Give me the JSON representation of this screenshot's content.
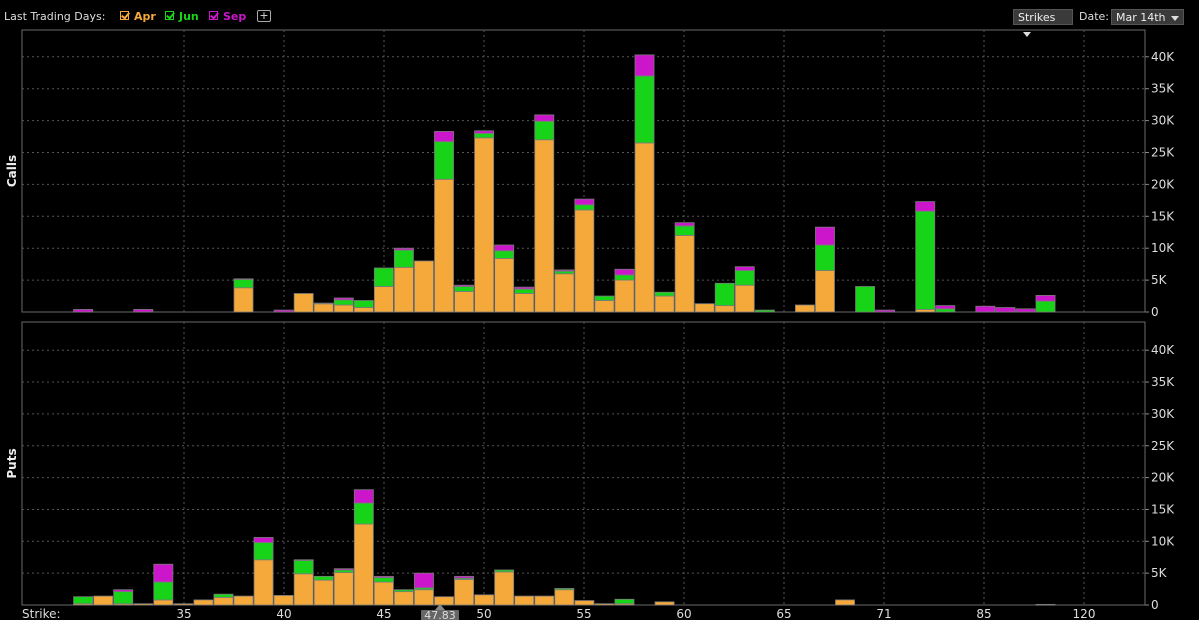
{
  "toolbar": {
    "last_trading_label": "Last Trading Days:",
    "series_toggles": [
      {
        "label": "Apr",
        "color": "#f4a93a"
      },
      {
        "label": "Jun",
        "color": "#18d418"
      },
      {
        "label": "Sep",
        "color": "#cc16cc"
      }
    ],
    "add_label": "+",
    "strikes_dropdown": "Strikes",
    "date_label": "Date:",
    "date_dropdown": "Mar 14th"
  },
  "chart_data": [
    {
      "type": "bar",
      "stacked": true,
      "panel_label": "Calls",
      "ylim": [
        0,
        44000
      ],
      "y_ticks": [
        "0",
        "5K",
        "10K",
        "15K",
        "20K",
        "25K",
        "30K",
        "35K",
        "40K"
      ],
      "x_ticks": [
        "35",
        "40",
        "45",
        "50",
        "55",
        "60",
        "65",
        "71",
        "85",
        "120"
      ],
      "grid": true,
      "series": [
        {
          "name": "Apr",
          "color": "#f4a93a",
          "values": [
            0,
            0,
            0,
            0,
            0,
            0,
            0,
            0,
            0,
            0,
            3800,
            0,
            0,
            2900,
            1300,
            1100,
            700,
            4000,
            7000,
            8000,
            20800,
            3200,
            27300,
            8400,
            2900,
            27000,
            6000,
            16000,
            1800,
            5000,
            26500,
            2500,
            12000,
            1300,
            1000,
            4200,
            0,
            0,
            1100,
            6500,
            0,
            0,
            0,
            0,
            400,
            0,
            0,
            0,
            0,
            0,
            0
          ]
        },
        {
          "name": "Jun",
          "color": "#18d418",
          "values": [
            0,
            0,
            0,
            0,
            0,
            0,
            0,
            0,
            0,
            0,
            1300,
            0,
            0,
            0,
            100,
            800,
            1100,
            2900,
            2700,
            0,
            5900,
            800,
            700,
            1200,
            700,
            2900,
            400,
            800,
            700,
            800,
            10500,
            600,
            1500,
            0,
            3500,
            2300,
            300,
            0,
            0,
            4000,
            0,
            4000,
            0,
            0,
            15400,
            500,
            0,
            0,
            0,
            0,
            1700
          ]
        },
        {
          "name": "Sep",
          "color": "#cc16cc",
          "values": [
            0,
            0,
            400,
            0,
            0,
            400,
            0,
            0,
            0,
            0,
            100,
            0,
            300,
            0,
            0,
            300,
            0,
            0,
            300,
            0,
            1600,
            200,
            400,
            900,
            300,
            1000,
            200,
            900,
            0,
            900,
            3300,
            0,
            500,
            0,
            0,
            600,
            0,
            0,
            0,
            2800,
            0,
            0,
            300,
            0,
            1500,
            500,
            0,
            900,
            700,
            500,
            900
          ]
        }
      ]
    },
    {
      "type": "bar",
      "stacked": true,
      "panel_label": "Puts",
      "ylim": [
        0,
        44000
      ],
      "y_ticks": [
        "0",
        "5K",
        "10K",
        "15K",
        "20K",
        "25K",
        "30K",
        "35K",
        "40K"
      ],
      "x_ticks": [
        "35",
        "40",
        "45",
        "50",
        "55",
        "60",
        "65",
        "71",
        "85",
        "120"
      ],
      "grid": true,
      "x_axis_label": "Strike:",
      "current_price_marker": "47.83",
      "series": [
        {
          "name": "Apr",
          "color": "#f4a93a",
          "values": [
            0,
            0,
            200,
            1400,
            200,
            200,
            800,
            200,
            800,
            1200,
            1400,
            7100,
            1500,
            4900,
            3900,
            5100,
            12700,
            3600,
            2100,
            2400,
            1300,
            4000,
            1600,
            5200,
            1400,
            1400,
            2400,
            700,
            200,
            200,
            0,
            500,
            0,
            0,
            0,
            0,
            0,
            0,
            0,
            0,
            800,
            0,
            0,
            0,
            0,
            0,
            0,
            0,
            0,
            0,
            0,
            0
          ]
        },
        {
          "name": "Jun",
          "color": "#18d418",
          "values": [
            0,
            0,
            1100,
            0,
            1900,
            0,
            2800,
            0,
            0,
            500,
            0,
            2700,
            0,
            2100,
            600,
            400,
            3300,
            700,
            300,
            300,
            0,
            200,
            0,
            300,
            0,
            0,
            200,
            0,
            0,
            700,
            0,
            0,
            0,
            0,
            0,
            0,
            0,
            0,
            0,
            0,
            0,
            0,
            0,
            0,
            0,
            0,
            0,
            0,
            0,
            0,
            0,
            0
          ]
        },
        {
          "name": "Sep",
          "color": "#cc16cc",
          "values": [
            0,
            0,
            0,
            0,
            300,
            0,
            2800,
            0,
            0,
            0,
            0,
            800,
            0,
            100,
            0,
            200,
            2100,
            200,
            0,
            2300,
            0,
            300,
            0,
            0,
            0,
            0,
            0,
            0,
            0,
            0,
            0,
            0,
            0,
            0,
            0,
            0,
            0,
            0,
            0,
            0,
            0,
            0,
            0,
            0,
            0,
            0,
            0,
            0,
            0,
            0,
            100,
            0
          ]
        }
      ]
    }
  ]
}
